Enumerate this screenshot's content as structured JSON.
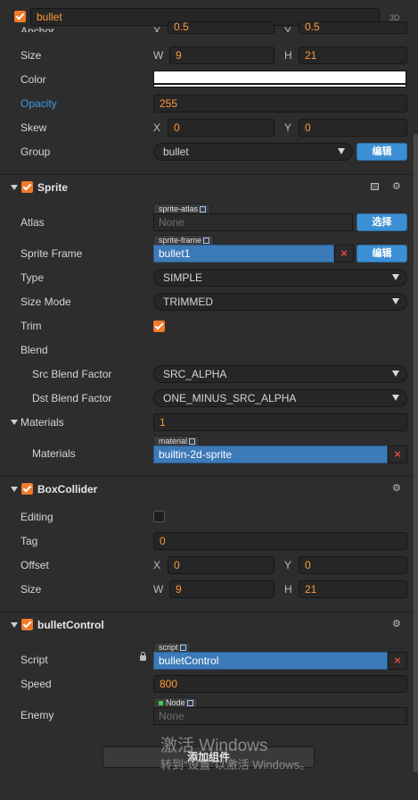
{
  "node": {
    "name": "bullet",
    "mode_3d": "3D"
  },
  "transform": {
    "anchor_label": "Anchor",
    "anchor_x": "0.5",
    "anchor_y": "0.5",
    "size_label": "Size",
    "w_label": "W",
    "h_label": "H",
    "width": "9",
    "height": "21",
    "color_label": "Color",
    "opacity_label": "Opacity",
    "opacity": "255",
    "skew_label": "Skew",
    "skew_x": "0",
    "skew_y": "0",
    "group_label": "Group",
    "group_value": "bullet",
    "edit_label": "编辑"
  },
  "xy": {
    "x": "X",
    "y": "Y"
  },
  "sprite": {
    "title": "Sprite",
    "atlas_label": "Atlas",
    "atlas_tag": "sprite-atlas",
    "atlas_value": "None",
    "select_label": "选择",
    "frame_label": "Sprite Frame",
    "frame_tag": "sprite-frame",
    "frame_value": "bullet1",
    "edit_label": "编辑",
    "type_label": "Type",
    "type_value": "SIMPLE",
    "sizemode_label": "Size Mode",
    "sizemode_value": "TRIMMED",
    "trim_label": "Trim",
    "blend_label": "Blend",
    "src_label": "Src Blend Factor",
    "src_value": "SRC_ALPHA",
    "dst_label": "Dst Blend Factor",
    "dst_value": "ONE_MINUS_SRC_ALPHA",
    "materials_label": "Materials",
    "materials_count": "1",
    "materials_item_label": "Materials",
    "material_tag": "material",
    "material_value": "builtin-2d-sprite"
  },
  "boxcollider": {
    "title": "BoxCollider",
    "editing_label": "Editing",
    "tag_label": "Tag",
    "tag_value": "0",
    "offset_label": "Offset",
    "offset_x": "0",
    "offset_y": "0",
    "size_label": "Size",
    "width": "9",
    "height": "21"
  },
  "bulletcontrol": {
    "title": "bulletControl",
    "script_label": "Script",
    "script_tag": "script",
    "script_value": "bulletControl",
    "speed_label": "Speed",
    "speed_value": "800",
    "enemy_label": "Enemy",
    "enemy_tag": "Node",
    "enemy_value": "None"
  },
  "footer": {
    "add_component": "添加组件"
  },
  "watermark": {
    "line1": "激活 Windows",
    "line2": "转到“设置”以激活 Windows。"
  },
  "colors": {
    "accent_orange": "#f07b2a",
    "accent_blue": "#3c8fd4",
    "value_orange": "#ff9a3c",
    "error_red": "#e04848"
  }
}
